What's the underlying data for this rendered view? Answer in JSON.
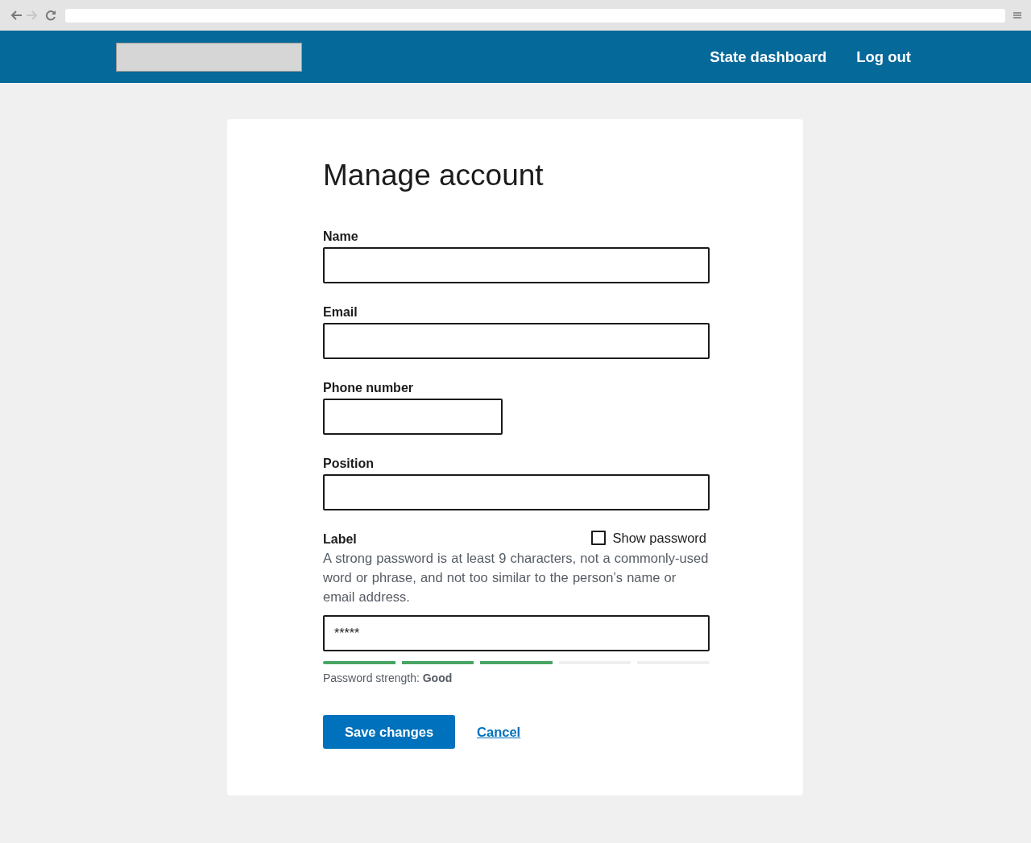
{
  "browser": {
    "forward_disabled": true
  },
  "header": {
    "nav": [
      {
        "label": "State dashboard"
      },
      {
        "label": "Log out"
      }
    ]
  },
  "form": {
    "title": "Manage account",
    "fields": [
      {
        "kind": "text",
        "label": "Name"
      },
      {
        "kind": "text",
        "label": "Email"
      },
      {
        "kind": "phone",
        "label": "Phone number"
      },
      {
        "kind": "text",
        "label": "Position"
      },
      {
        "kind": "password",
        "label": "Label",
        "show_password": {
          "label": "Show password",
          "checked": false
        },
        "hint": "A strong password is at least 9 characters, not a commonly-used word or phrase, and not too similar to the person’s name or email address.",
        "value": "*****",
        "strength": {
          "level": 0.6,
          "text": "Password strength: **Good**"
        }
      }
    ],
    "actions": [
      {
        "kind": "primary",
        "label": "Save changes"
      },
      {
        "kind": "link",
        "label": "Cancel"
      }
    ]
  }
}
